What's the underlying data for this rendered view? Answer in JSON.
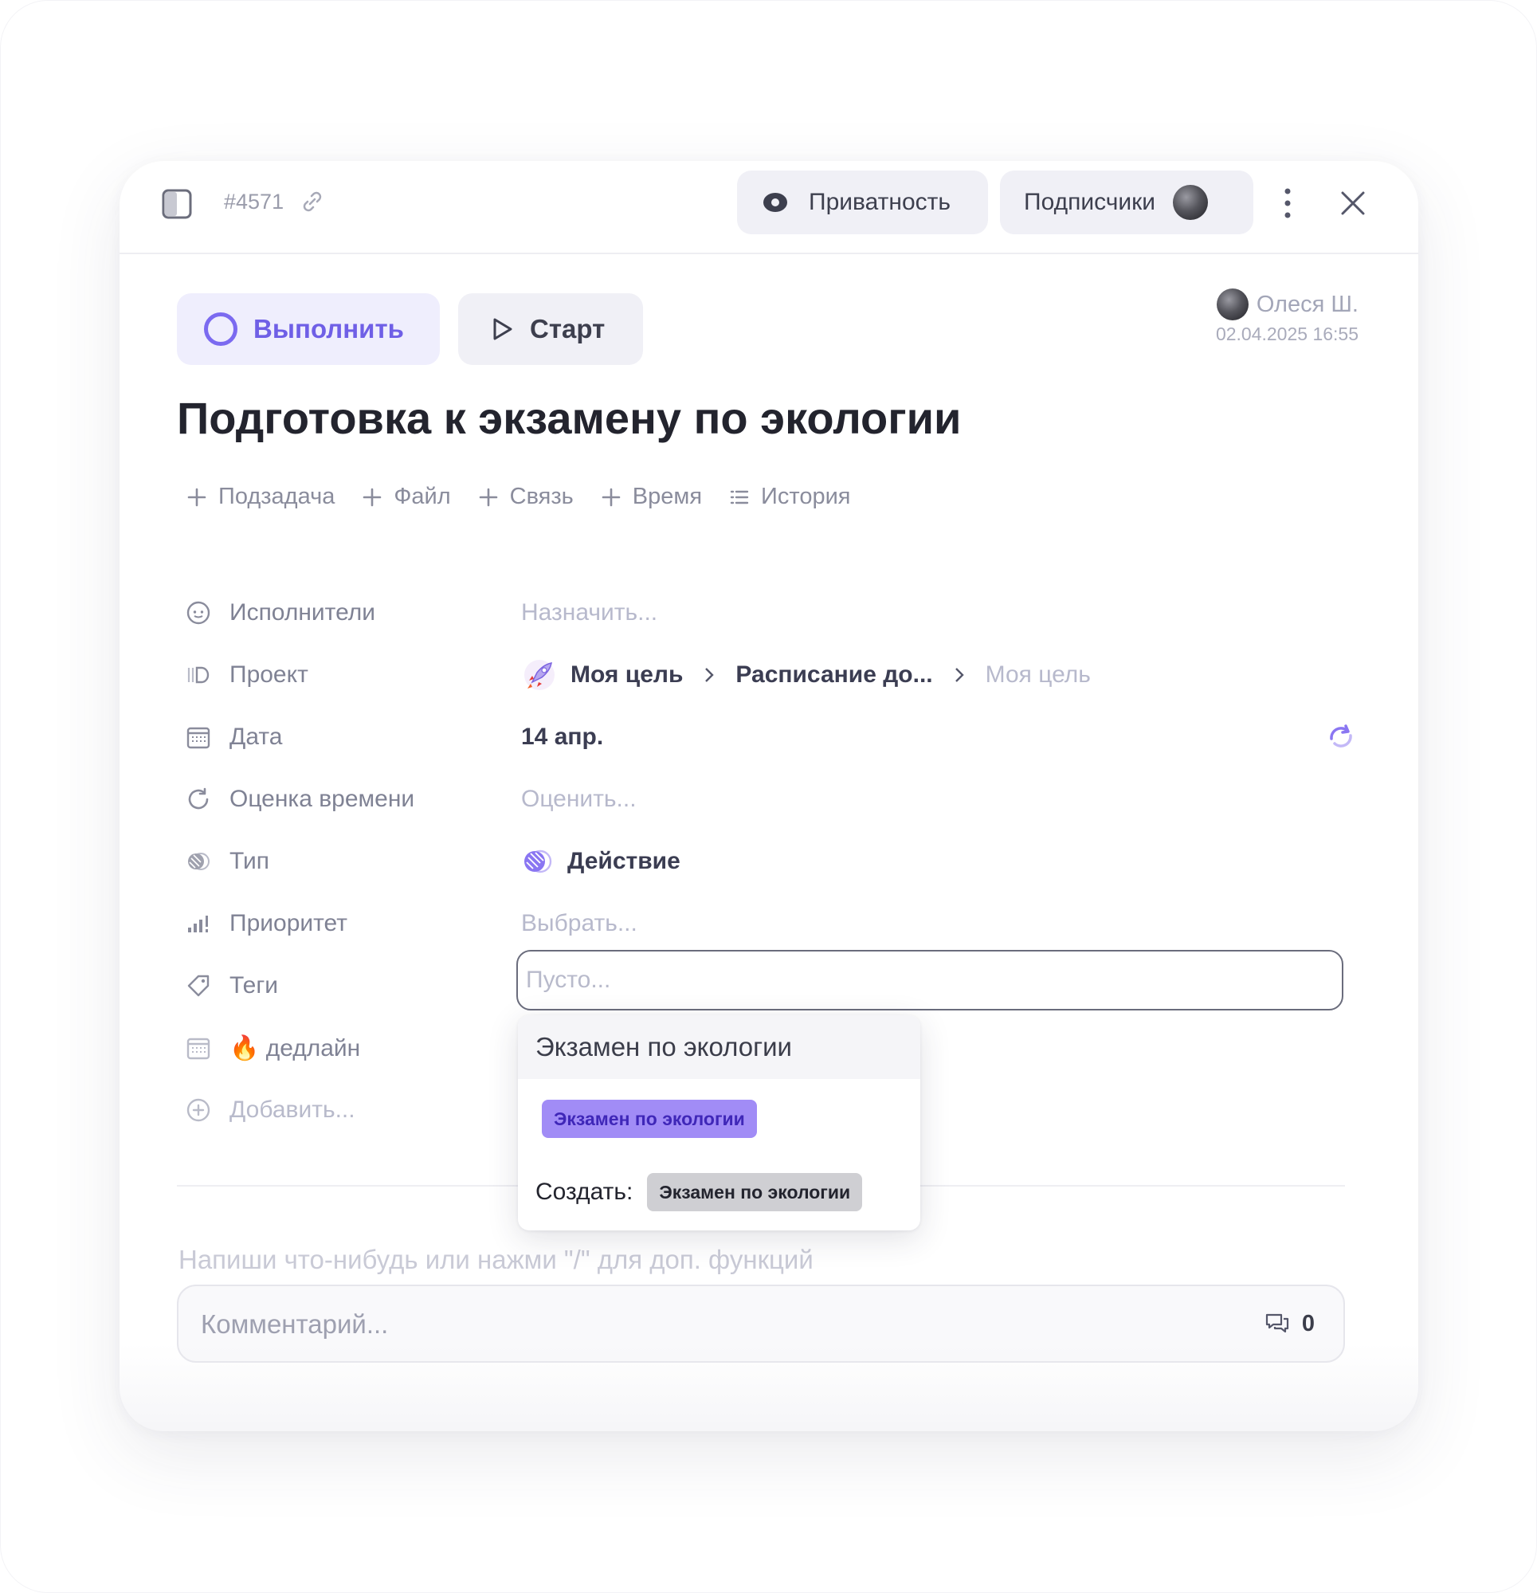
{
  "header": {
    "task_id": "#4571",
    "privacy_label": "Приватность",
    "subscribers_label": "Подписчики"
  },
  "actions": {
    "complete_label": "Выполнить",
    "start_label": "Старт"
  },
  "author": {
    "name": "Олеся Ш.",
    "date": "02.04.2025 16:55"
  },
  "task": {
    "title": "Подготовка к экзамену по экологии"
  },
  "toolbar": {
    "items": [
      "Подзадача",
      "Файл",
      "Связь",
      "Время",
      "История"
    ]
  },
  "fields": {
    "assignees": {
      "label": "Исполнители",
      "value": "Назначить..."
    },
    "project": {
      "label": "Проект",
      "crumbs": [
        "Моя цель",
        "Расписание до...",
        "Моя цель"
      ]
    },
    "date": {
      "label": "Дата",
      "value": "14 апр."
    },
    "estimate": {
      "label": "Оценка времени",
      "value": "Оценить..."
    },
    "type": {
      "label": "Тип",
      "value": "Действие"
    },
    "priority": {
      "label": "Приоритет",
      "value": "Выбрать..."
    },
    "tags": {
      "label": "Теги",
      "placeholder": "Пусто..."
    },
    "deadline": {
      "label": "🔥 дедлайн"
    },
    "add": {
      "label": "Добавить..."
    }
  },
  "tag_dropdown": {
    "query": "Экзамен по экологии",
    "existing_tag": "Экзамен по экологии",
    "create_label": "Создать:",
    "create_tag": "Экзамен по экологии"
  },
  "comment": {
    "hint": "Напиши что-нибудь или нажми \"/\" для доп. функций",
    "placeholder": "Комментарий...",
    "count": "0"
  },
  "colors": {
    "accent": "#7b6af0",
    "tag_bg": "#a18cf6",
    "muted_text": "#b7b9cc"
  }
}
